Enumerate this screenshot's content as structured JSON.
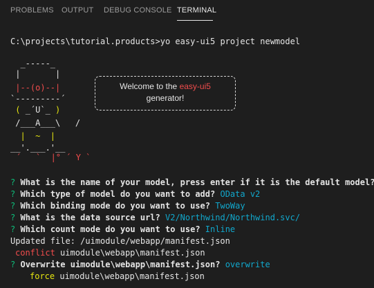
{
  "panel_tabs": [
    {
      "label": "PROBLEMS",
      "active": false
    },
    {
      "label": "OUTPUT",
      "active": false
    },
    {
      "label": "DEBUG CONSOLE",
      "active": false
    },
    {
      "label": "TERMINAL",
      "active": true
    }
  ],
  "terminal": {
    "prompt": "C:\\projects\\tutorial.products>",
    "command": "yo easy-ui5 project newmodel",
    "ascii_art": {
      "line1": "  _-----_",
      "line2": " |       |",
      "line3": " |--(o)--|",
      "line4": "`---------´",
      "line5": " ( ",
      "line5_face": "_´U`_",
      "line5_end": " )",
      "line6": " /___A___\\   /",
      "line7": "  |  ~  |",
      "line8": "__'.___.'__",
      "line9": "´   `  |° ´ Y `"
    },
    "welcome": {
      "prefix": "Welcome to the ",
      "highlight": "easy-ui5",
      "suffix": "generator!"
    },
    "questions": [
      {
        "mark": "?",
        "text": "What is the name of your model, press enter if it is the default model?",
        "answer": ""
      },
      {
        "mark": "?",
        "text": "Which type of model do you want to add?",
        "answer": "OData v2"
      },
      {
        "mark": "?",
        "text": "Which binding mode do you want to use?",
        "answer": "TwoWay"
      },
      {
        "mark": "?",
        "text": "What is the data source url?",
        "answer": "V2/Northwind/Northwind.svc/"
      },
      {
        "mark": "?",
        "text": "Which count mode do you want to use?",
        "answer": "Inline"
      }
    ],
    "updated": "Updated file: /uimodule/webapp/manifest.json",
    "conflict": {
      "label": "conflict",
      "path": "uimodule\\webapp\\manifest.json"
    },
    "overwrite": {
      "mark": "?",
      "text": "Overwrite uimodule\\webapp\\manifest.json?",
      "answer": "overwrite"
    },
    "force": {
      "label": "force",
      "path": "uimodule\\webapp\\manifest.json"
    }
  },
  "colors": {
    "background": "#1e1e1e",
    "prompt_green": "#0dbc79",
    "answer_cyan": "#11a8cd",
    "conflict_red": "#f14c4c",
    "force_yellow": "#e5e510"
  }
}
